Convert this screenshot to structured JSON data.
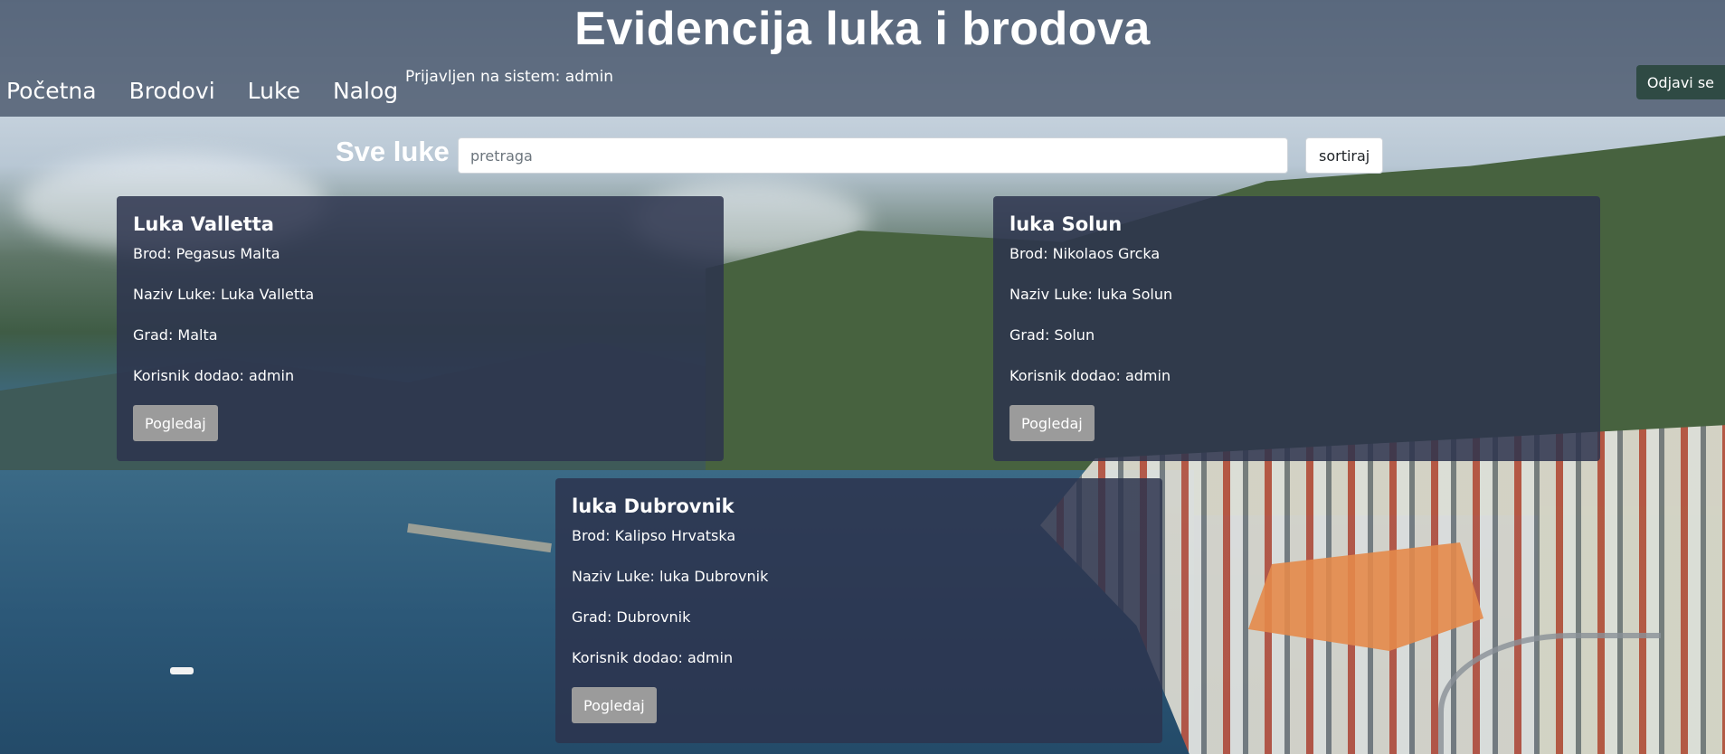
{
  "header": {
    "title": "Evidencija luka i brodova",
    "nav": [
      {
        "label": "Početna"
      },
      {
        "label": "Brodovi"
      },
      {
        "label": "Luke"
      },
      {
        "label": "Nalog"
      }
    ],
    "logged_in_text": "Prijavljen na sistem: admin",
    "logout_label": "Odjavi se"
  },
  "toolbar": {
    "section_title": "Sve luke",
    "search_placeholder": "pretraga",
    "sort_label": "sortiraj"
  },
  "ports": [
    {
      "title": "Luka Valletta",
      "ship": "Brod: Pegasus Malta",
      "port_name": "Naziv Luke: Luka Valletta",
      "city": "Grad: Malta",
      "added_by": "Korisnik dodao: admin",
      "view_label": "Pogledaj"
    },
    {
      "title": "luka Solun",
      "ship": "Brod: Nikolaos Grcka",
      "port_name": "Naziv Luke: luka Solun",
      "city": "Grad: Solun",
      "added_by": "Korisnik dodao: admin",
      "view_label": "Pogledaj"
    },
    {
      "title": "luka Dubrovnik",
      "ship": "Brod: Kalipso Hrvatska",
      "port_name": "Naziv Luke: luka Dubrovnik",
      "city": "Grad: Dubrovnik",
      "added_by": "Korisnik dodao: admin",
      "view_label": "Pogledaj"
    }
  ],
  "colors": {
    "header_bg": "#4b586c",
    "card_bg": "#2d344e",
    "button_grey": "#9b9b9b",
    "logout_bg": "#2f4a44"
  }
}
